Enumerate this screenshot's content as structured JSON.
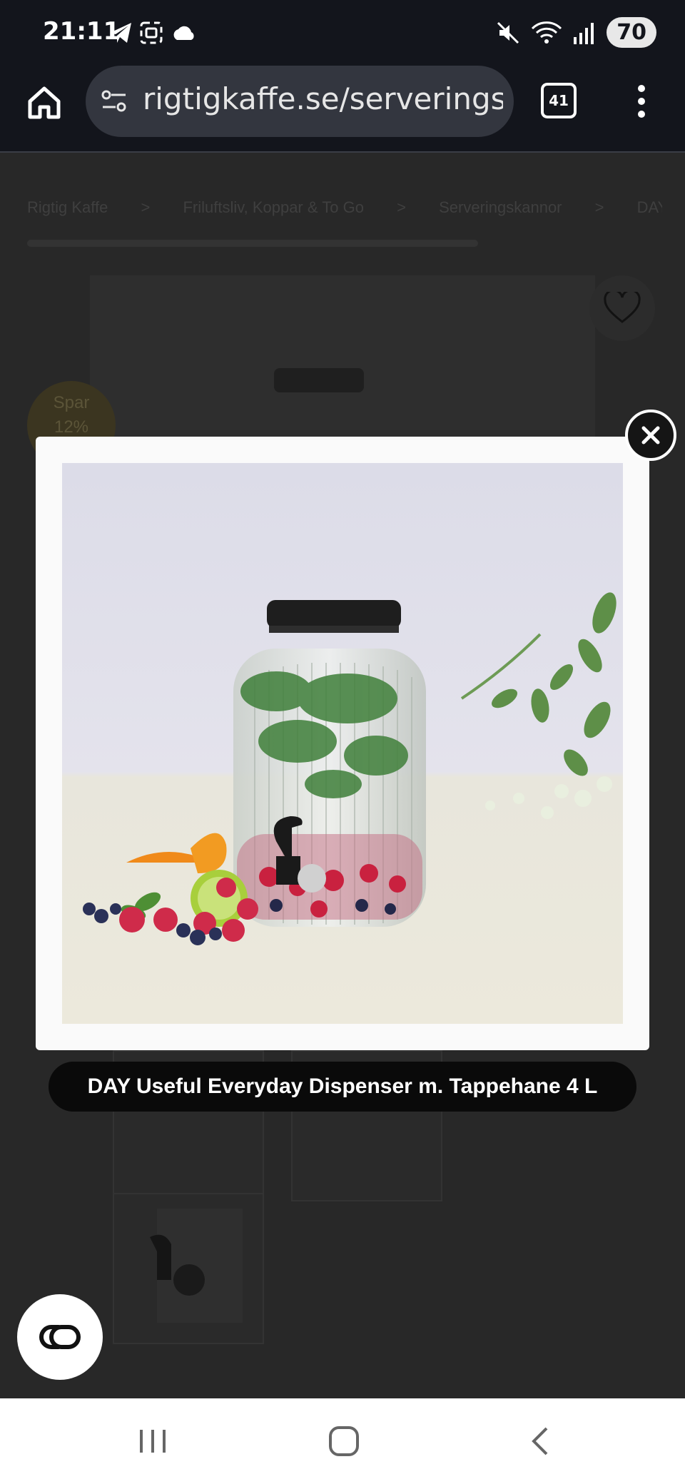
{
  "status_bar": {
    "time": "21:11",
    "battery": "70"
  },
  "browser": {
    "url": "rigtigkaffe.se/serveringsk",
    "tab_count": "41"
  },
  "breadcrumb": [
    "Rigtig Kaffe",
    ">",
    "Friluftsliv, Koppar & To Go",
    ">",
    "Serveringskannor",
    ">",
    "DAY Useful Ever"
  ],
  "sale_badge": {
    "line1": "Spar",
    "line2": "12%"
  },
  "lightbox": {
    "caption": "DAY Useful Everyday Dispenser m. Tappehane 4 L"
  },
  "colors": {
    "status_bg": "#13151c",
    "url_bg": "#33363f",
    "overlay_bg": "#282828",
    "lightbox_bg": "#fafafa",
    "caption_bg": "#0a0a0a"
  },
  "icons": [
    "telegram-icon",
    "screenshot-icon",
    "cloud-icon",
    "mute-icon",
    "wifi-icon",
    "signal-icon",
    "home-icon",
    "tune-icon",
    "more-vert-icon",
    "heart-icon",
    "close-icon",
    "chat-icon",
    "recents-icon",
    "home-nav-icon",
    "back-icon"
  ]
}
